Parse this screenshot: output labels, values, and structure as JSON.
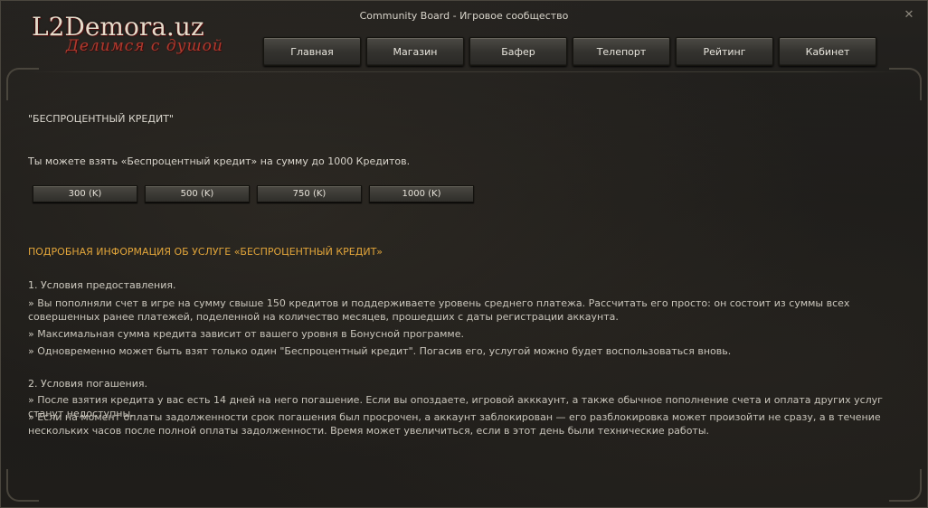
{
  "window": {
    "title": "Community Board - Игровое сообщество",
    "close_glyph": "✕"
  },
  "logo": {
    "main": "L2Demora.uz",
    "sub": "Делимся с душой"
  },
  "nav": [
    "Главная",
    "Магазин",
    "Бафер",
    "Телепорт",
    "Рейтинг",
    "Кабинет"
  ],
  "content": {
    "heading": "\"БЕСПРОЦЕНТНЫЙ КРЕДИТ\"",
    "intro": "Ты можете взять «Беспроцентный кредит» на сумму до 1000 Кредитов.",
    "credit_options": [
      "300 (K)",
      "500 (K)",
      "750 (K)",
      "1000 (K)"
    ],
    "info_title": "ПОДРОБНАЯ ИНФОРМАЦИЯ ОБ УСЛУГЕ «БЕСПРОЦЕНТНЫЙ КРЕДИТ»",
    "section1": {
      "title": "1. Условия предоставления.",
      "items": [
        "» Вы пополняли счет в игре на сумму свыше 150 кредитов и поддерживаете уровень среднего платежа. Рассчитать его просто: он состоит из суммы всех совершенных ранее платежей, поделенной на количество месяцев, прошедших с даты регистрации аккаунта.",
        "» Максимальная сумма кредита зависит от вашего уровня в Бонусной программе.",
        "» Одновременно может быть взят только один \"Беспроцентный кредит\". Погасив его, услугой можно будет воспользоваться вновь."
      ]
    },
    "section2": {
      "title": "2. Условия погашения.",
      "items": [
        "» После взятия кредита у вас есть 14 дней на него погашение. Если вы опоздаете, игровой акккаунт, а также обычное пополнение счета и оплата других услуг станут недоступны.",
        "» Если на момент оплаты задолженности срок погашения был просрочен, а аккаунт заблокирован — его разблокировка может произойти не сразу, а в течение нескольких часов после полной оплаты задолженности. Время может увеличиться, если в этот день были технические работы."
      ]
    }
  },
  "colors": {
    "accent": "#e2a53a",
    "text": "#c9c5bb",
    "background": "#1f1d1a"
  }
}
